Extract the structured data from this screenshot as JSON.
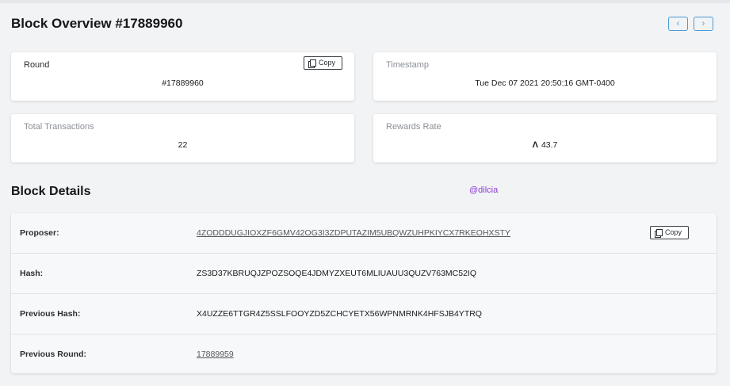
{
  "page": {
    "title": "Block Overview #17889960",
    "nav_prev_icon": "chevron-left-icon",
    "nav_next_icon": "chevron-right-icon"
  },
  "cards": {
    "round": {
      "label": "Round",
      "value": "#17889960",
      "copy_label": "Copy"
    },
    "timestamp": {
      "label": "Timestamp",
      "value": "Tue Dec 07 2021 20:50:16 GMT-0400"
    },
    "total_transactions": {
      "label": "Total Transactions",
      "value": "22"
    },
    "rewards_rate": {
      "label": "Rewards Rate",
      "value": "43.7",
      "icon": "algorand-icon"
    }
  },
  "details": {
    "title": "Block Details",
    "watermark": "@dilcia",
    "rows": [
      {
        "label": "Proposer:",
        "value": "4ZODDDUGJIOXZF6GMV42OG3I3ZDPUTAZIM5UBQWZUHPKIYCX7RKEOHXSTY",
        "copy_label": "Copy"
      },
      {
        "label": "Hash:",
        "value": "ZS3D37KBRUQJZPOZSOQE4JDMYZXEUT6MLIUAUU3QUZV763MC52IQ"
      },
      {
        "label": "Previous Hash:",
        "value": "X4UZZE6TTGR4Z5SSLFOOYZD5ZCHCYETX56WPNMRNK4HFSJB4YTRQ"
      },
      {
        "label": "Previous Round:",
        "value": "17889959"
      }
    ]
  }
}
